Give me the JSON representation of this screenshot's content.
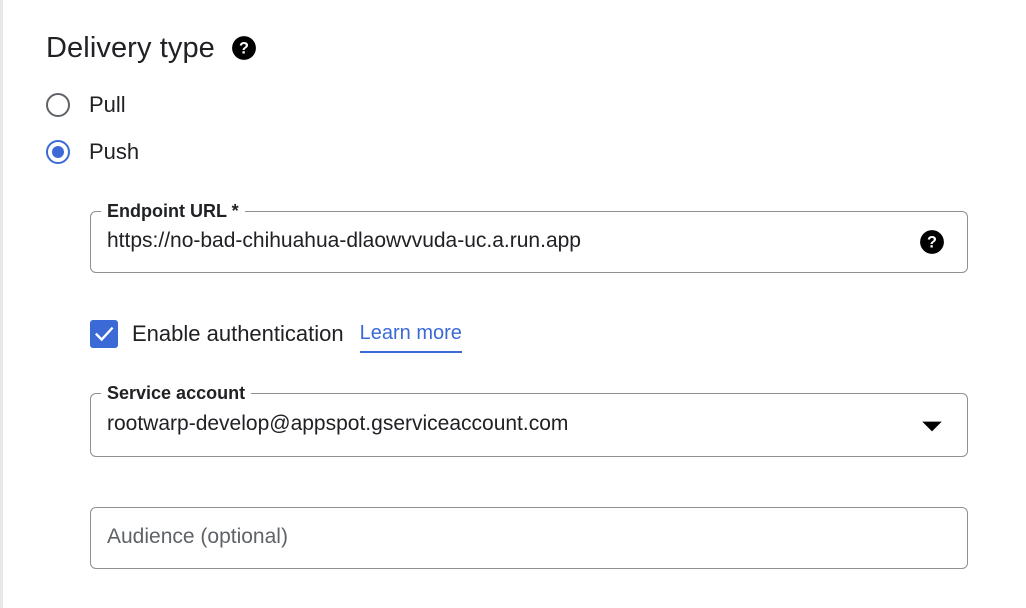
{
  "section": {
    "title": "Delivery type"
  },
  "delivery_options": [
    {
      "label": "Pull",
      "selected": false
    },
    {
      "label": "Push",
      "selected": true
    }
  ],
  "endpoint": {
    "label": "Endpoint URL *",
    "value": "https://no-bad-chihuahua-dlaowvvuda-uc.a.run.app",
    "icon": "help-icon"
  },
  "authentication": {
    "label": "Enable authentication",
    "checked": true,
    "link_text": "Learn more"
  },
  "service_account": {
    "label": "Service account",
    "value": "rootwarp-develop@appspot.gserviceaccount.com",
    "icon": "dropdown-arrow-icon"
  },
  "audience": {
    "placeholder": "Audience (optional)",
    "value": ""
  },
  "colors": {
    "accent": "#3b6ad6",
    "text": "#202124",
    "border": "#8f8f8f"
  }
}
